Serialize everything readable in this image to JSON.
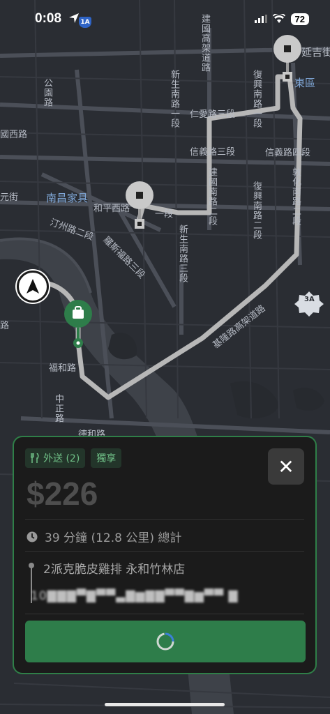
{
  "status_bar": {
    "time": "0:08",
    "highway_badge": "1A",
    "battery": "72"
  },
  "map": {
    "labels": [
      "延吉街",
      "東區",
      "公園路",
      "國西路",
      "新生南路一段",
      "建國高架道路",
      "仁愛路三段",
      "復興南路一段",
      "信義路三段",
      "信義路四段",
      "南昌家具",
      "和平西路",
      "一段",
      "汀州路二段",
      "羅斯福路三段",
      "新生南路三段",
      "建國南路二段",
      "復興南路二段",
      "敦化南路二段",
      "基隆路高架道路",
      "福和路",
      "中正路",
      "德和路",
      "元街",
      "路",
      "3A"
    ]
  },
  "card": {
    "tags": [
      {
        "icon": "fork-knife-icon",
        "label": "外送 (2)"
      },
      {
        "label": "獨享"
      }
    ],
    "close_label": "✕",
    "price": "$226",
    "time_summary": "39 分鐘 (12.8 公里) 總計",
    "store": "2派克脆皮雞排 永和竹林店",
    "address": "10▇▇▇▀▇▀▀▃▇▆▇▇▀▀▇▆▀▀ ▇"
  },
  "colors": {
    "accent": "#2e7d4a",
    "card_bg": "#1b1b1b",
    "map_bg": "#2a2d33",
    "route": "#b7b7b7"
  }
}
